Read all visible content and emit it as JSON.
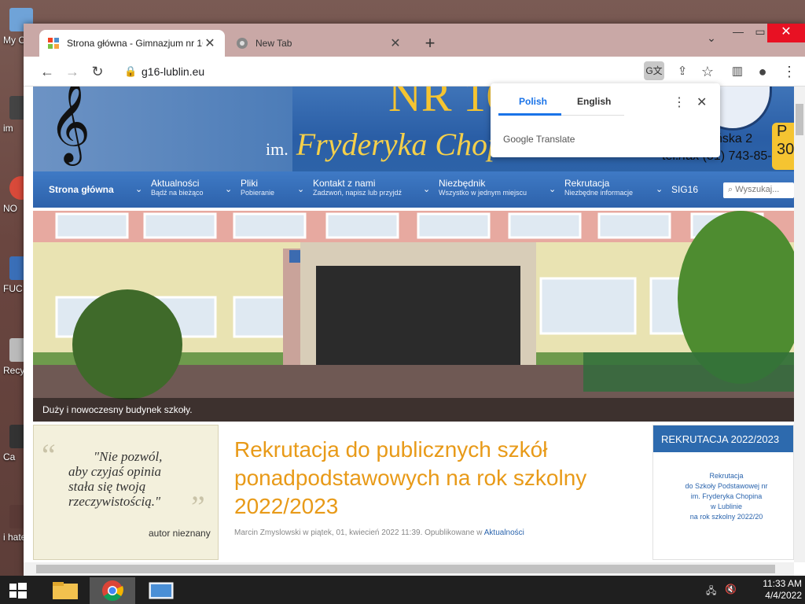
{
  "desktop": {
    "icons": [
      {
        "label": "My C"
      },
      {
        "label": "im"
      },
      {
        "label": "NO"
      },
      {
        "label": "FUC"
      },
      {
        "label": "Recy"
      },
      {
        "label": "Ca"
      },
      {
        "label": "i hate"
      }
    ]
  },
  "browser": {
    "tabs": [
      {
        "title": "Strona główna - Gimnazjum nr 16",
        "icon": "joomla-icon"
      },
      {
        "title": "New Tab",
        "icon": "chrome-icon"
      }
    ],
    "url": "g16-lublin.eu"
  },
  "site": {
    "banner": {
      "nr": "NR 16",
      "im": "im.",
      "patron": "Fryderyka Chopina",
      "address": "yńska 2",
      "phone": "tel./fax (81) 743-85-30",
      "seal_text": "OPINA W LUBLIN",
      "badge": "P 30"
    },
    "nav": {
      "home": "Strona główna",
      "items": [
        {
          "label": "Aktualności",
          "sub": "Bądź na bieżąco"
        },
        {
          "label": "Pliki",
          "sub": "Pobieranie"
        },
        {
          "label": "Kontakt z nami",
          "sub": "Zadzwoń, napisz lub przyjdź"
        },
        {
          "label": "Niezbędnik",
          "sub": "Wszystko w jednym miejscu"
        },
        {
          "label": "Rekrutacja",
          "sub": "Niezbędne informacje"
        },
        {
          "label": "SIG16",
          "sub": ""
        }
      ],
      "search_placeholder": "Wyszukaj..."
    },
    "slide_caption": "Duży i nowoczesny budynek szkoły.",
    "quote": {
      "text_lines": [
        "\"Nie pozwól,",
        "aby czyjaś opinia",
        "stała się twoją",
        "rzeczywistością.\""
      ],
      "author": "autor nieznany"
    },
    "article": {
      "title": "Rekrutacja do publicznych szkół ponadpodstawowych na rok szkolny 2022/2023",
      "meta": "Marcin Zmyslowski w piątek, 01, kwiecień 2022 11:39. Opublikowane w",
      "category": "Aktualności"
    },
    "sidebar": {
      "heading": "REKRUTACJA 2022/2023",
      "poster_lines": [
        "Rekrutacja",
        "do Szkoły Podstawowej nr",
        "im. Fryderyka Chopina",
        "w Lublinie",
        "na rok szkolny 2022/20"
      ]
    }
  },
  "translate_popup": {
    "tabs": [
      "Polish",
      "English"
    ],
    "selected": "Polish",
    "brand": "Google Translate"
  },
  "taskbar": {
    "time": "11:33 AM",
    "date": "4/4/2022"
  }
}
